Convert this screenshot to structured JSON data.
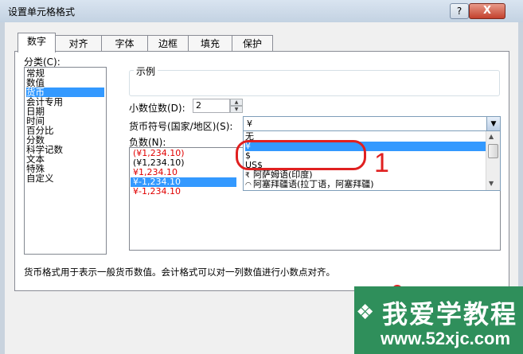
{
  "window": {
    "title": "设置单元格格式",
    "help_label": "?",
    "close_label": "X"
  },
  "tabs": [
    {
      "label": "数字",
      "active": true
    },
    {
      "label": "对齐",
      "active": false
    },
    {
      "label": "字体",
      "active": false
    },
    {
      "label": "边框",
      "active": false
    },
    {
      "label": "填充",
      "active": false
    },
    {
      "label": "保护",
      "active": false
    }
  ],
  "category": {
    "label": "分类(C):",
    "items": [
      "常规",
      "数值",
      "货币",
      "会计专用",
      "日期",
      "时间",
      "百分比",
      "分数",
      "科学记数",
      "文本",
      "特殊",
      "自定义"
    ],
    "selected_index": 2
  },
  "sample": {
    "label": "示例"
  },
  "decimal": {
    "label": "小数位数(D):",
    "value": "2"
  },
  "currency": {
    "label": "货币符号(国家/地区)(S):",
    "value": "¥",
    "options": [
      "无",
      "¥",
      "$",
      "US$",
      "阿萨姆语(印度)",
      "阿塞拜疆语(拉丁语，阿塞拜疆)"
    ],
    "selected_index": 1
  },
  "negative": {
    "label": "负数(N):",
    "items": [
      "(¥1,234.10)",
      "(¥1,234.10)",
      "¥1,234.10",
      "¥-1,234.10",
      "¥-1,234.10"
    ]
  },
  "description": "货币格式用于表示一般货币数值。会计格式可以对一列数值进行小数点对齐。",
  "annotation": {
    "marker": "1"
  },
  "watermark": {
    "title": "我爱学教程",
    "url": "www.52xjc.com"
  },
  "colors": {
    "accent": "#3399ff",
    "annotation": "#e02020",
    "negative": "#e00000",
    "watermark": "#2f8f5b"
  }
}
